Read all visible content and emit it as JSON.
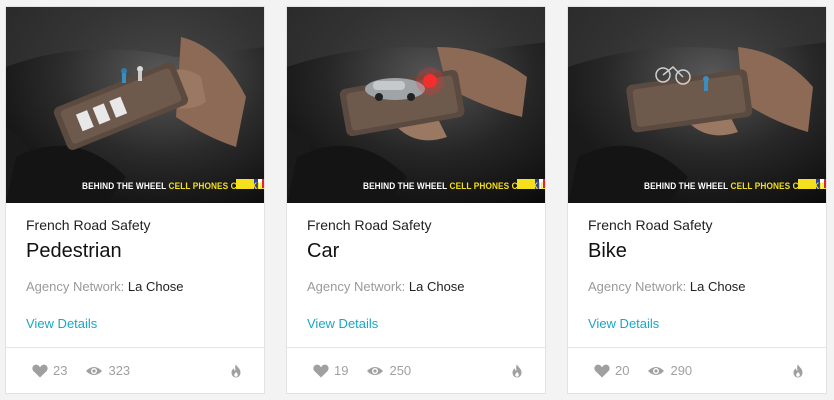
{
  "cards": [
    {
      "client": "French Road Safety",
      "title": "Pedestrian",
      "agency_label": "Agency Network:",
      "agency_value": "La Chose",
      "details_label": "View Details",
      "likes": "23",
      "views": "323",
      "tagline_white": "BEHIND THE WHEEL",
      "tagline_yellow": "CELL PHONES CAN KILL",
      "image_subject": "pedestrian-crossing"
    },
    {
      "client": "French Road Safety",
      "title": "Car",
      "agency_label": "Agency Network:",
      "agency_value": "La Chose",
      "details_label": "View Details",
      "likes": "19",
      "views": "250",
      "tagline_white": "BEHIND THE WHEEL",
      "tagline_yellow": "CELL PHONES CAN KILL",
      "image_subject": "car-crash"
    },
    {
      "client": "French Road Safety",
      "title": "Bike",
      "agency_label": "Agency Network:",
      "agency_value": "La Chose",
      "details_label": "View Details",
      "likes": "20",
      "views": "290",
      "tagline_white": "BEHIND THE WHEEL",
      "tagline_yellow": "CELL PHONES CAN KILL",
      "image_subject": "bike-crash"
    }
  ],
  "icons": {
    "like": "heart-icon",
    "views": "eye-icon",
    "trending": "flame-icon"
  },
  "colors": {
    "accent": "#1aa6c6",
    "muted": "#a0a0a0",
    "tagline_highlight": "#f4e01c"
  }
}
